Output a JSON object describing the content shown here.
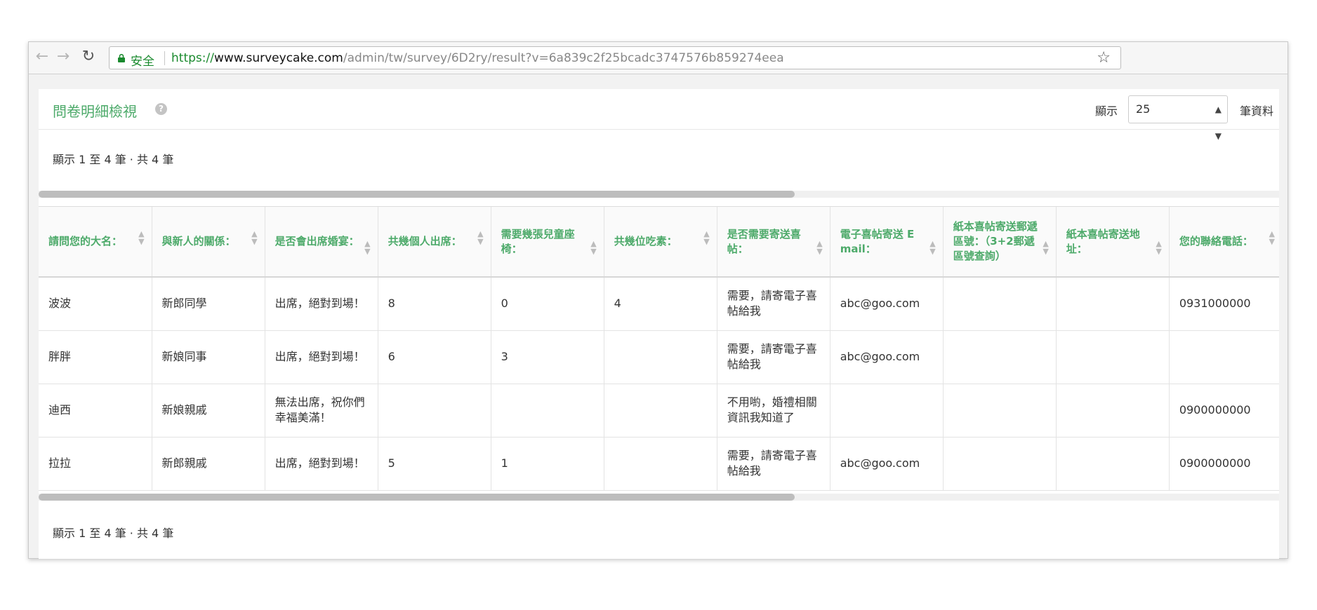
{
  "browser": {
    "secure_label": "安全",
    "url_scheme": "https://",
    "url_host": "www.surveycake.com",
    "url_path": "/admin/tw/survey/6D2ry/result?v=6a839c2f25bcadc3747576b859274eea"
  },
  "panel": {
    "title": "問卷明細檢視",
    "show_label": "顯示",
    "page_size": "25",
    "records_label": "筆資料",
    "info_top": "顯示 1 至 4 筆 · 共 4 筆",
    "info_bottom": "顯示 1 至 4 筆 · 共 4 筆"
  },
  "colors": {
    "accent": "#4daa6a",
    "secure": "#1a8a2e"
  },
  "table": {
    "columns": [
      "請問您的大名：",
      "與新人的關係：",
      "是否會出席婚宴：",
      "共幾個人出席：",
      "需要幾張兒童座椅：",
      "共幾位吃素：",
      "是否需要寄送喜帖：",
      "電子喜帖寄送 E mail：",
      "紙本喜帖寄送郵遞區號：（3+2郵遞區號查詢）",
      "紙本喜帖寄送地址：",
      "您的聯絡電話："
    ],
    "rows": [
      [
        "波波",
        "新郎同學",
        "出席，絕對到場！",
        "8",
        "0",
        "4",
        "需要，請寄電子喜帖給我",
        "abc@goo.com",
        "",
        "",
        "0931000000"
      ],
      [
        "胖胖",
        "新娘同事",
        "出席，絕對到場！",
        "6",
        "3",
        "",
        "需要，請寄電子喜帖給我",
        "abc@goo.com",
        "",
        "",
        ""
      ],
      [
        "迪西",
        "新娘親戚",
        "無法出席，祝你們幸福美滿！",
        "",
        "",
        "",
        "不用喲，婚禮相關資訊我知道了",
        "",
        "",
        "",
        "0900000000"
      ],
      [
        "拉拉",
        "新郎親戚",
        "出席，絕對到場！",
        "5",
        "1",
        "",
        "需要，請寄電子喜帖給我",
        "abc@goo.com",
        "",
        "",
        "0900000000"
      ]
    ]
  }
}
